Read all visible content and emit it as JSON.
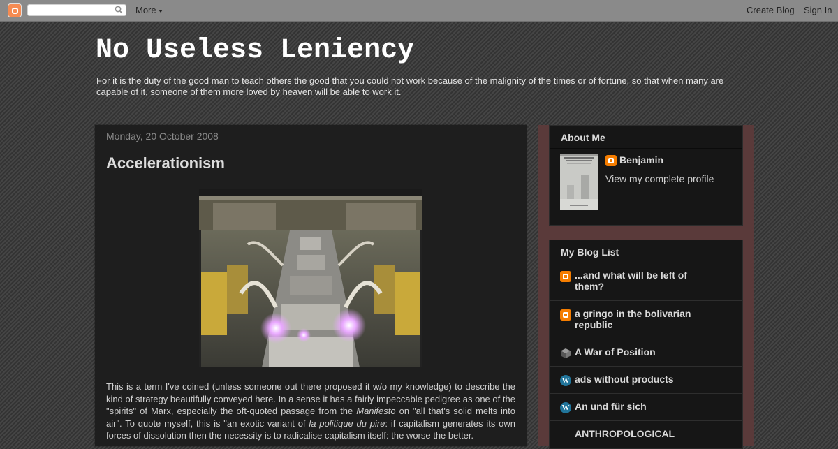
{
  "navbar": {
    "more_label": "More",
    "create_blog_label": "Create Blog",
    "sign_in_label": "Sign In"
  },
  "blog": {
    "title": "No Useless Leniency",
    "description": "For it is the duty of the good man to teach others the good that you could not work because of the malignity of the times or of fortune, so that when many are capable of it, someone of them more loved by heaven will be able to work it."
  },
  "post": {
    "date": "Monday, 20 October 2008",
    "title": "Accelerationism",
    "body": {
      "p1": "This is a term I've coined (unless someone out there proposed it w/o my knowledge) to describe the kind of strategy beautifully conveyed here. In a sense it has a fairly impeccable pedigree as one of the \"spirits\" of Marx, especially the oft-quoted passage from the ",
      "manifesto": "Manifesto",
      "p2": " on \"all that's solid melts into air\". To quote myself, this is \"an exotic variant of ",
      "politique": "la politique du pire",
      "p3": ": if capitalism generates its own forces of dissolution then the necessity is to radicalise capitalism itself: the worse the better."
    }
  },
  "about": {
    "title": "About Me",
    "name": "Benjamin",
    "profile_link": "View my complete profile"
  },
  "blog_list": {
    "title": "My Blog List",
    "items": [
      {
        "label": "...and what will be left of them?",
        "icon": "blogger-icon"
      },
      {
        "label": "a gringo in the bolivarian republic",
        "icon": "blogger-icon"
      },
      {
        "label": "A War of Position",
        "icon": "cube-icon"
      },
      {
        "label": "ads without products",
        "icon": "wordpress-icon"
      },
      {
        "label": "An und für sich",
        "icon": "wordpress-icon"
      },
      {
        "label": "ANTHROPOLOGICAL",
        "icon": ""
      }
    ]
  },
  "colors": {
    "navbar": "#8a8a8a",
    "main_bg": "#1e1e1e",
    "sidebar_bg": "#5a3a3a",
    "widget_bg": "#161616",
    "blogger_orange": "#f57d00"
  }
}
